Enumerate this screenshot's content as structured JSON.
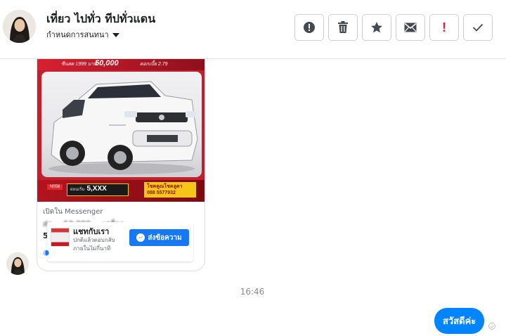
{
  "header": {
    "contact_name": "เที่ยว ไปทั่ว ทีปทั่วแดน",
    "manage_label": "กำหนดการสนทนา",
    "actions": [
      {
        "name": "report-icon",
        "label": ""
      },
      {
        "name": "delete-icon",
        "label": ""
      },
      {
        "name": "star-icon",
        "label": ""
      },
      {
        "name": "mail-icon",
        "label": ""
      },
      {
        "name": "flag-icon",
        "label": "!"
      },
      {
        "name": "check-icon",
        "label": ""
      }
    ]
  },
  "shared_post": {
    "top_prices": [
      "ซีนสด 1999 บาท",
      "50,000",
      "ดอกเบี้ย 2.79"
    ],
    "tag": "N056",
    "price_prefix": "ผ่อนเริ่ม",
    "price": "5,XXX",
    "tel_line1": "โชคคูณโชคลูคา",
    "tel_line2": "088 5577932",
    "open_in": "เปิดใน Messenger",
    "blurred_line": "ส่ง ... 50,000 ... เครื่อง...",
    "blurred_prefix": "5",
    "sub_card": {
      "title": "แชทกับเรา",
      "description": "ปกติแล้วตอบกลับภายในไม่กี่นาที",
      "button": "ส่งข้อความ"
    },
    "footer": "🌘"
  },
  "timestamp": "16:46",
  "outgoing_message": "สวัสดีค่ะ",
  "colors": {
    "accent": "#0084ff",
    "button": "#1877f2",
    "border": "#dddfe2",
    "flag": "#e41e3f"
  }
}
